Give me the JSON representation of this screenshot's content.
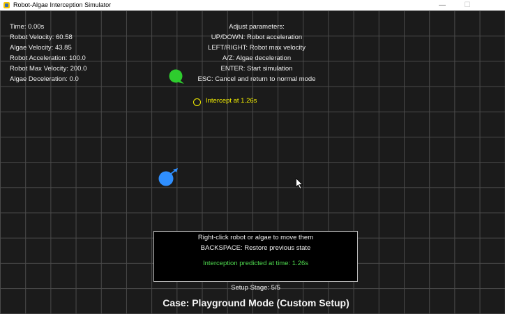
{
  "window": {
    "title": "Robot-Algae Interception Simulator",
    "icon": "python-app-icon",
    "minimize_glyph": "—",
    "restore_glyph": "☐"
  },
  "hud": {
    "time": "Time: 0.00s",
    "robot_velocity": "Robot Velocity: 60.58",
    "algae_velocity": "Algae Velocity: 43.85",
    "robot_acceleration": "Robot Acceleration: 100.0",
    "robot_max_velocity": "Robot Max Velocity: 200.0",
    "algae_deceleration": "Algae Deceleration: 0.0"
  },
  "help": {
    "heading": "Adjust parameters:",
    "up_down": "UP/DOWN: Robot acceleration",
    "left_right": "LEFT/RIGHT: Robot max velocity",
    "a_z": "A/Z: Algae deceleration",
    "enter": "ENTER: Start simulation",
    "esc": "ESC: Cancel and return to normal mode"
  },
  "scene": {
    "intercept_label": "Intercept at 1.26s",
    "algae_color": "#2ecc2e",
    "robot_color": "#2f8fff",
    "intercept_color": "#f5f000"
  },
  "panel": {
    "line1": "Right-click robot or algae to move them",
    "line2": "BACKSPACE: Restore previous state",
    "prediction": "Interception predicted at time: 1.26s"
  },
  "footer": {
    "setup_stage": "Setup Stage: 5/5",
    "case_title": "Case: Playground Mode (Custom Setup)"
  }
}
